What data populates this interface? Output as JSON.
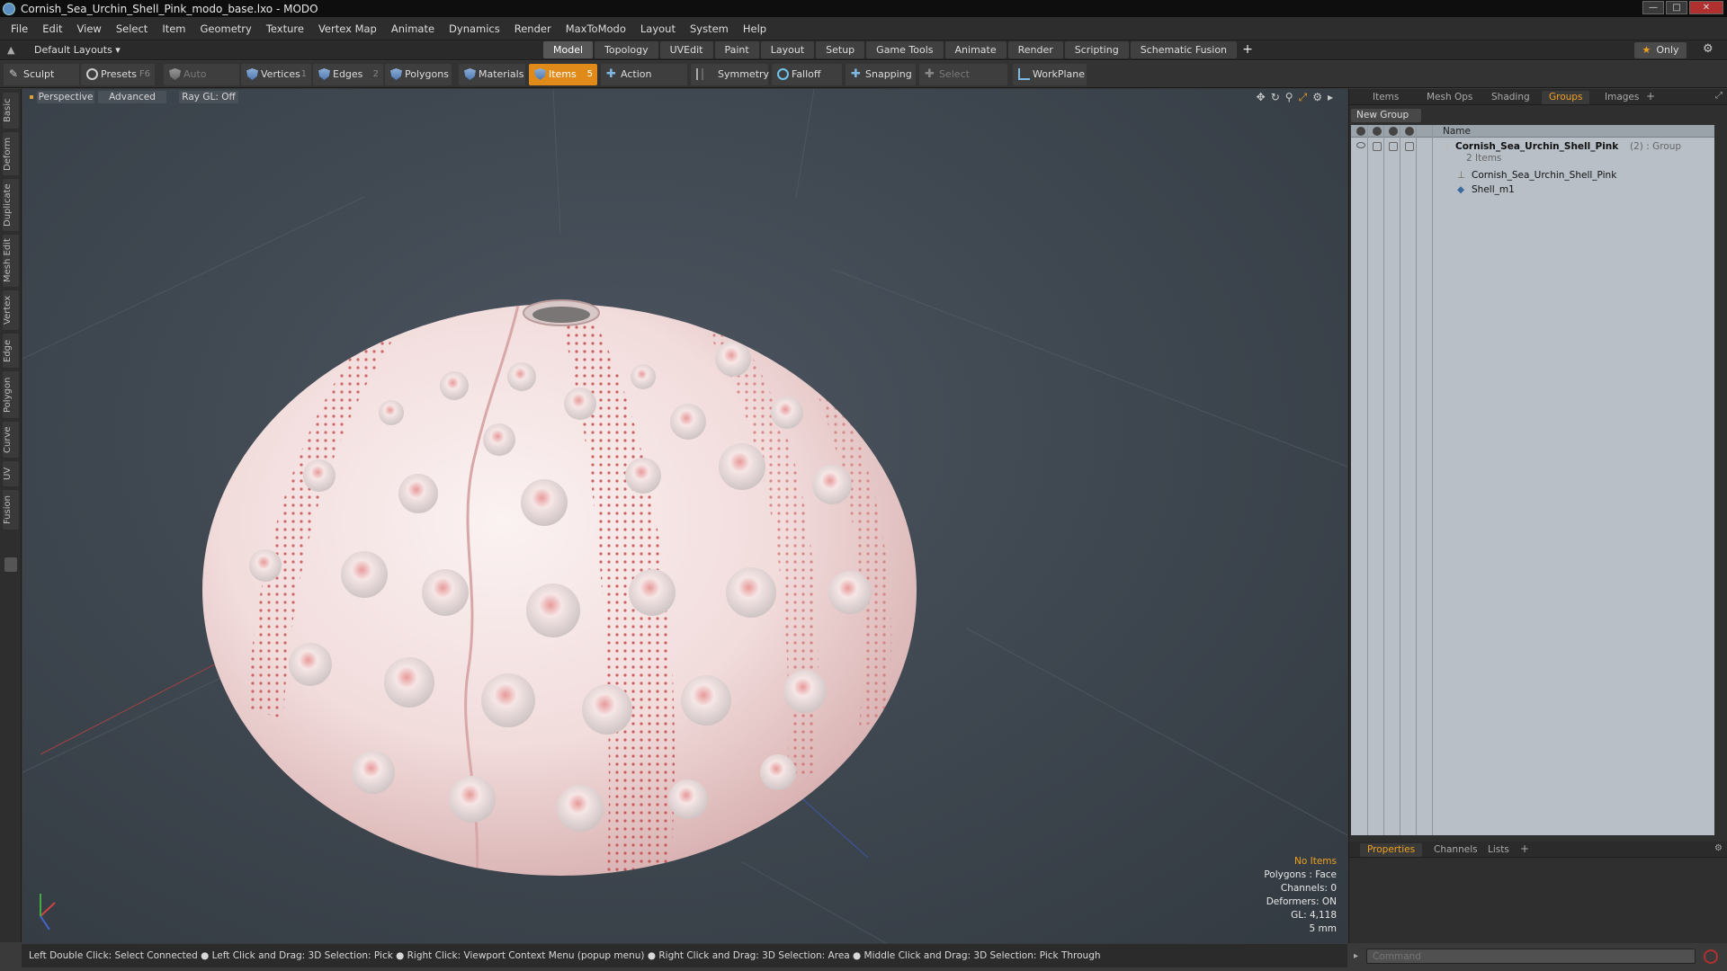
{
  "window": {
    "title": "Cornish_Sea_Urchin_Shell_Pink_modo_base.lxo - MODO"
  },
  "menu": [
    "File",
    "Edit",
    "View",
    "Select",
    "Item",
    "Geometry",
    "Texture",
    "Vertex Map",
    "Animate",
    "Dynamics",
    "Render",
    "MaxToModo",
    "Layout",
    "System",
    "Help"
  ],
  "layout_bar": {
    "layout_dropdown": "Default Layouts ▾",
    "tabs": [
      "Model",
      "Topology",
      "UVEdit",
      "Paint",
      "Layout",
      "Setup",
      "Game Tools",
      "Animate",
      "Render",
      "Scripting",
      "Schematic Fusion"
    ],
    "active_tab": "Model",
    "add_tab": "+",
    "only_label": "Only"
  },
  "toolbar": {
    "sculpt": "Sculpt",
    "presets": "Presets",
    "presets_key": "F6",
    "auto_select": "Auto Select",
    "vertices": "Vertices",
    "vertices_key": "1",
    "edges": "Edges",
    "edges_key": "2",
    "polygons": "Polygons",
    "materials": "Materials",
    "items": "Items",
    "items_key": "5",
    "action_center": "Action Center",
    "symmetry": "Symmetry",
    "falloff": "Falloff",
    "snapping": "Snapping",
    "select_through": "Select Through",
    "workplane": "WorkPlane"
  },
  "left_tabs": [
    "Basic",
    "Deform",
    "Duplicate",
    "Mesh Edit",
    "Vertex",
    "Edge",
    "Polygon",
    "Curve",
    "UV",
    "Fusion"
  ],
  "viewport": {
    "view_mode": "Perspective",
    "shading": "Advanced",
    "raygl": "Ray GL: Off",
    "stats": {
      "selection": "No Items",
      "polygons": "Polygons : Face",
      "channels": "Channels: 0",
      "deformers": "Deformers: ON",
      "gl": "GL: 4,118",
      "unit": "5 mm"
    }
  },
  "right_panel": {
    "tabs": [
      "Items",
      "Mesh Ops",
      "Shading",
      "Groups",
      "Images"
    ],
    "active_tab": "Groups",
    "new_group": "New Group",
    "column_name": "Name",
    "rows": [
      {
        "label": "Cornish_Sea_Urchin_Shell_Pink",
        "suffix": "(2) : Group",
        "sub": "2 Items"
      },
      {
        "label": "Cornish_Sea_Urchin_Shell_Pink"
      },
      {
        "label": "Shell_m1"
      }
    ],
    "bottom_tabs": [
      "Properties",
      "Channels",
      "Lists"
    ],
    "bottom_active": "Properties"
  },
  "command": {
    "placeholder": "Command"
  },
  "statusbar": {
    "text": "Left Double Click: Select Connected ● Left Click and Drag: 3D Selection: Pick ● Right Click: Viewport Context Menu (popup menu) ● Right Click and Drag: 3D Selection: Area ● Middle Click and Drag: 3D Selection: Pick Through"
  },
  "colors": {
    "accent": "#f0a020",
    "active_tool": "#e08a1a",
    "shell_base": "#f4e4e4",
    "shell_spots": "#c84848"
  }
}
